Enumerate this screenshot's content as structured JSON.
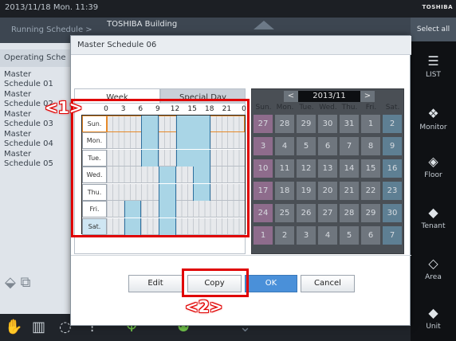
{
  "topbar": {
    "datetime": "2013/11/18  Mon.  11:39",
    "brand": "TOSHIBA"
  },
  "background": {
    "breadcrumb": "Running Schedule",
    "breadcrumb_arrow": ">",
    "building": "TOSHIBA Building",
    "left_header": "Operating Sche",
    "left_items": [
      "Master\nSchedule 01",
      "Master\nSchedule 02",
      "Master\nSchedule 03",
      "Master\nSchedule 04",
      "Master\nSchedule 05"
    ]
  },
  "sidebar": {
    "select_all": "Select all",
    "nav": [
      {
        "icon": "list-icon",
        "label": "LIST"
      },
      {
        "icon": "monitor-icon",
        "label": "Monitor"
      },
      {
        "icon": "floor-icon",
        "label": "Floor"
      },
      {
        "icon": "tenant-icon",
        "label": "Tenant"
      },
      {
        "icon": "area-icon",
        "label": "Area"
      },
      {
        "icon": "unit-icon",
        "label": "Unit"
      }
    ]
  },
  "dialog": {
    "title": "Master Schedule 06",
    "tabs": {
      "week": "Week",
      "special_day": "Special Day"
    },
    "scale": [
      "0",
      "3",
      "6",
      "9",
      "12",
      "15",
      "18",
      "21",
      "0"
    ],
    "days": [
      {
        "label": "Sun.",
        "type": "sun",
        "segments": [
          [
            6,
            9
          ],
          [
            12,
            18
          ]
        ]
      },
      {
        "label": "Mon.",
        "type": "weekday",
        "segments": [
          [
            6,
            9
          ],
          [
            12,
            18
          ]
        ]
      },
      {
        "label": "Tue.",
        "type": "weekday",
        "segments": [
          [
            6,
            9
          ],
          [
            12,
            18
          ]
        ]
      },
      {
        "label": "Wed.",
        "type": "weekday",
        "segments": [
          [
            9,
            12
          ],
          [
            15,
            18
          ]
        ]
      },
      {
        "label": "Thu.",
        "type": "weekday",
        "segments": [
          [
            9,
            12
          ],
          [
            15,
            18
          ]
        ]
      },
      {
        "label": "Fri.",
        "type": "weekday",
        "segments": [
          [
            3,
            6
          ],
          [
            9,
            12
          ]
        ]
      },
      {
        "label": "Sat.",
        "type": "sat",
        "segments": [
          [
            3,
            6
          ],
          [
            9,
            12
          ]
        ]
      }
    ],
    "calendar": {
      "prev": "<",
      "next": ">",
      "month": "2013/11",
      "dows": [
        "Sun.",
        "Mon.",
        "Tue.",
        "Wed.",
        "Thu.",
        "Fri.",
        "Sat."
      ],
      "weeks": [
        [
          "27",
          "28",
          "29",
          "30",
          "31",
          "1",
          "2"
        ],
        [
          "3",
          "4",
          "5",
          "6",
          "7",
          "8",
          "9"
        ],
        [
          "10",
          "11",
          "12",
          "13",
          "14",
          "15",
          "16"
        ],
        [
          "17",
          "18",
          "19",
          "20",
          "21",
          "22",
          "23"
        ],
        [
          "24",
          "25",
          "26",
          "27",
          "28",
          "29",
          "30"
        ],
        [
          "1",
          "2",
          "3",
          "4",
          "5",
          "6",
          "7"
        ]
      ]
    },
    "buttons": {
      "edit": "Edit",
      "copy": "Copy",
      "ok": "OK",
      "cancel": "Cancel"
    }
  },
  "callouts": {
    "one": "<1>",
    "two": "<2>"
  },
  "colors": {
    "highlight": "#e00000",
    "segment": "#a9d5e6",
    "ok_button": "#4a90d9"
  }
}
